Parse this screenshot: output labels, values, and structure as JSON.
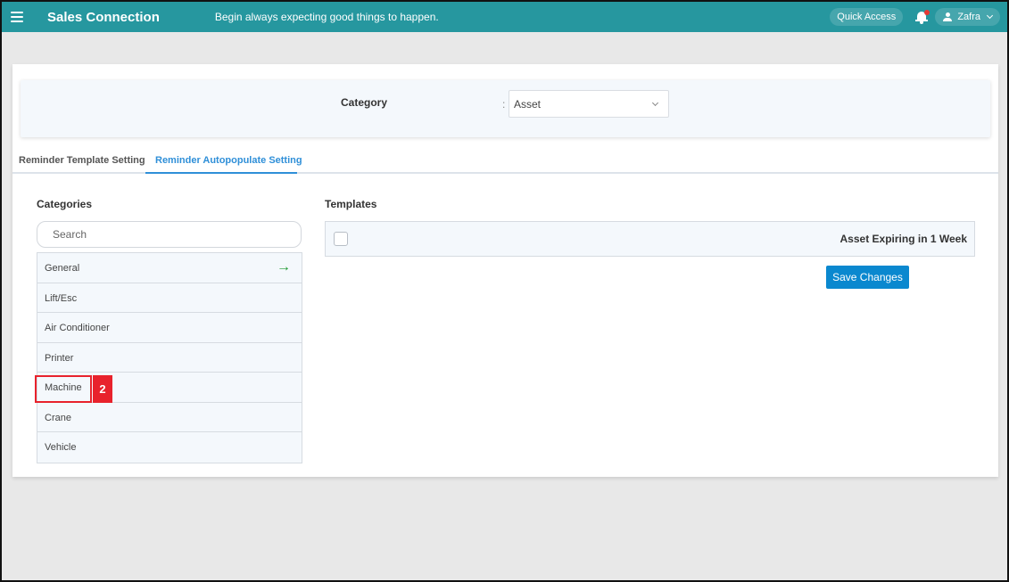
{
  "header": {
    "app_title": "Sales Connection",
    "tagline": "Begin always expecting good things to happen.",
    "quick_access_label": "Quick Access",
    "user_name": "Zafra",
    "notification_dot": true
  },
  "filter": {
    "label": "Category",
    "colon": ":",
    "selected_value": "Asset"
  },
  "tabs": [
    {
      "label": "Reminder Template Setting",
      "active": false
    },
    {
      "label": "Reminder Autopopulate Setting",
      "active": true
    }
  ],
  "categories": {
    "heading": "Categories",
    "search_placeholder": "Search",
    "items": [
      {
        "label": "General",
        "selected": true
      },
      {
        "label": "Lift/Esc"
      },
      {
        "label": "Air Conditioner"
      },
      {
        "label": "Printer"
      },
      {
        "label": "Machine",
        "annotated": true
      },
      {
        "label": "Crane"
      },
      {
        "label": "Vehicle"
      }
    ],
    "annotation_number": "2"
  },
  "templates": {
    "heading": "Templates",
    "items": [
      {
        "label": "Asset Expiring in 1 Week",
        "checked": false
      }
    ],
    "save_label": "Save Changes"
  },
  "colors": {
    "header_bg": "#26979f",
    "active_tab": "#2f8fd8",
    "save_button": "#0a88cf",
    "annotation_red": "#e8222c",
    "arrow_green": "#1e9a32"
  }
}
